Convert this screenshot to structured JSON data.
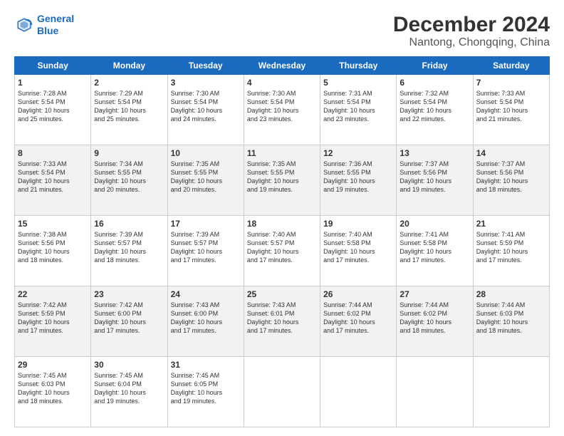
{
  "header": {
    "logo_line1": "General",
    "logo_line2": "Blue",
    "month": "December 2024",
    "location": "Nantong, Chongqing, China"
  },
  "weekdays": [
    "Sunday",
    "Monday",
    "Tuesday",
    "Wednesday",
    "Thursday",
    "Friday",
    "Saturday"
  ],
  "weeks": [
    [
      {
        "day": "1",
        "lines": [
          "Sunrise: 7:28 AM",
          "Sunset: 5:54 PM",
          "Daylight: 10 hours",
          "and 25 minutes."
        ]
      },
      {
        "day": "2",
        "lines": [
          "Sunrise: 7:29 AM",
          "Sunset: 5:54 PM",
          "Daylight: 10 hours",
          "and 25 minutes."
        ]
      },
      {
        "day": "3",
        "lines": [
          "Sunrise: 7:30 AM",
          "Sunset: 5:54 PM",
          "Daylight: 10 hours",
          "and 24 minutes."
        ]
      },
      {
        "day": "4",
        "lines": [
          "Sunrise: 7:30 AM",
          "Sunset: 5:54 PM",
          "Daylight: 10 hours",
          "and 23 minutes."
        ]
      },
      {
        "day": "5",
        "lines": [
          "Sunrise: 7:31 AM",
          "Sunset: 5:54 PM",
          "Daylight: 10 hours",
          "and 23 minutes."
        ]
      },
      {
        "day": "6",
        "lines": [
          "Sunrise: 7:32 AM",
          "Sunset: 5:54 PM",
          "Daylight: 10 hours",
          "and 22 minutes."
        ]
      },
      {
        "day": "7",
        "lines": [
          "Sunrise: 7:33 AM",
          "Sunset: 5:54 PM",
          "Daylight: 10 hours",
          "and 21 minutes."
        ]
      }
    ],
    [
      {
        "day": "8",
        "lines": [
          "Sunrise: 7:33 AM",
          "Sunset: 5:54 PM",
          "Daylight: 10 hours",
          "and 21 minutes."
        ]
      },
      {
        "day": "9",
        "lines": [
          "Sunrise: 7:34 AM",
          "Sunset: 5:55 PM",
          "Daylight: 10 hours",
          "and 20 minutes."
        ]
      },
      {
        "day": "10",
        "lines": [
          "Sunrise: 7:35 AM",
          "Sunset: 5:55 PM",
          "Daylight: 10 hours",
          "and 20 minutes."
        ]
      },
      {
        "day": "11",
        "lines": [
          "Sunrise: 7:35 AM",
          "Sunset: 5:55 PM",
          "Daylight: 10 hours",
          "and 19 minutes."
        ]
      },
      {
        "day": "12",
        "lines": [
          "Sunrise: 7:36 AM",
          "Sunset: 5:55 PM",
          "Daylight: 10 hours",
          "and 19 minutes."
        ]
      },
      {
        "day": "13",
        "lines": [
          "Sunrise: 7:37 AM",
          "Sunset: 5:56 PM",
          "Daylight: 10 hours",
          "and 19 minutes."
        ]
      },
      {
        "day": "14",
        "lines": [
          "Sunrise: 7:37 AM",
          "Sunset: 5:56 PM",
          "Daylight: 10 hours",
          "and 18 minutes."
        ]
      }
    ],
    [
      {
        "day": "15",
        "lines": [
          "Sunrise: 7:38 AM",
          "Sunset: 5:56 PM",
          "Daylight: 10 hours",
          "and 18 minutes."
        ]
      },
      {
        "day": "16",
        "lines": [
          "Sunrise: 7:39 AM",
          "Sunset: 5:57 PM",
          "Daylight: 10 hours",
          "and 18 minutes."
        ]
      },
      {
        "day": "17",
        "lines": [
          "Sunrise: 7:39 AM",
          "Sunset: 5:57 PM",
          "Daylight: 10 hours",
          "and 17 minutes."
        ]
      },
      {
        "day": "18",
        "lines": [
          "Sunrise: 7:40 AM",
          "Sunset: 5:57 PM",
          "Daylight: 10 hours",
          "and 17 minutes."
        ]
      },
      {
        "day": "19",
        "lines": [
          "Sunrise: 7:40 AM",
          "Sunset: 5:58 PM",
          "Daylight: 10 hours",
          "and 17 minutes."
        ]
      },
      {
        "day": "20",
        "lines": [
          "Sunrise: 7:41 AM",
          "Sunset: 5:58 PM",
          "Daylight: 10 hours",
          "and 17 minutes."
        ]
      },
      {
        "day": "21",
        "lines": [
          "Sunrise: 7:41 AM",
          "Sunset: 5:59 PM",
          "Daylight: 10 hours",
          "and 17 minutes."
        ]
      }
    ],
    [
      {
        "day": "22",
        "lines": [
          "Sunrise: 7:42 AM",
          "Sunset: 5:59 PM",
          "Daylight: 10 hours",
          "and 17 minutes."
        ]
      },
      {
        "day": "23",
        "lines": [
          "Sunrise: 7:42 AM",
          "Sunset: 6:00 PM",
          "Daylight: 10 hours",
          "and 17 minutes."
        ]
      },
      {
        "day": "24",
        "lines": [
          "Sunrise: 7:43 AM",
          "Sunset: 6:00 PM",
          "Daylight: 10 hours",
          "and 17 minutes."
        ]
      },
      {
        "day": "25",
        "lines": [
          "Sunrise: 7:43 AM",
          "Sunset: 6:01 PM",
          "Daylight: 10 hours",
          "and 17 minutes."
        ]
      },
      {
        "day": "26",
        "lines": [
          "Sunrise: 7:44 AM",
          "Sunset: 6:02 PM",
          "Daylight: 10 hours",
          "and 17 minutes."
        ]
      },
      {
        "day": "27",
        "lines": [
          "Sunrise: 7:44 AM",
          "Sunset: 6:02 PM",
          "Daylight: 10 hours",
          "and 18 minutes."
        ]
      },
      {
        "day": "28",
        "lines": [
          "Sunrise: 7:44 AM",
          "Sunset: 6:03 PM",
          "Daylight: 10 hours",
          "and 18 minutes."
        ]
      }
    ],
    [
      {
        "day": "29",
        "lines": [
          "Sunrise: 7:45 AM",
          "Sunset: 6:03 PM",
          "Daylight: 10 hours",
          "and 18 minutes."
        ]
      },
      {
        "day": "30",
        "lines": [
          "Sunrise: 7:45 AM",
          "Sunset: 6:04 PM",
          "Daylight: 10 hours",
          "and 19 minutes."
        ]
      },
      {
        "day": "31",
        "lines": [
          "Sunrise: 7:45 AM",
          "Sunset: 6:05 PM",
          "Daylight: 10 hours",
          "and 19 minutes."
        ]
      },
      null,
      null,
      null,
      null
    ]
  ]
}
